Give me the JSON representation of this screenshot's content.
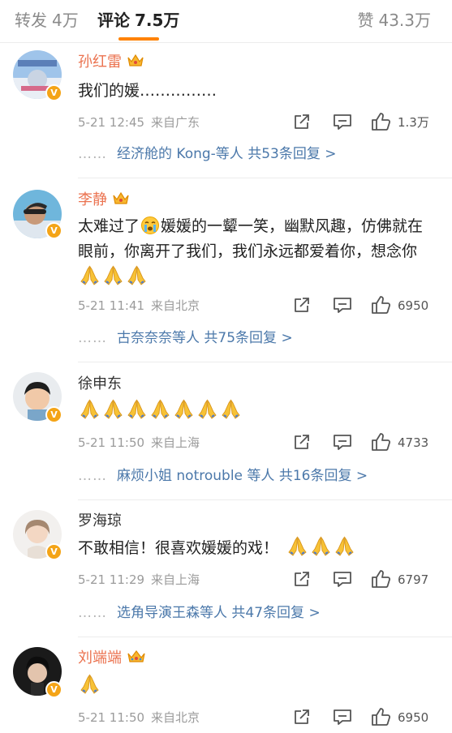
{
  "tabs": {
    "repost": {
      "label": "转发",
      "count": "4万"
    },
    "comment": {
      "label": "评论",
      "count": "7.5万"
    },
    "like": {
      "label": "赞",
      "count": "43.3万"
    }
  },
  "colors": {
    "accent": "#ff8200",
    "vip_name": "#eb7350",
    "link": "#4b78aa",
    "verified_badge": "#f4a417"
  },
  "icons": {
    "share": "share-icon",
    "reply": "comment-icon",
    "like": "thumbs-up-icon",
    "crown": "crown-icon",
    "verified": "verified-v-icon",
    "emoji_pray": "pray-emoji",
    "emoji_cry": "crying-emoji"
  },
  "comments": [
    {
      "name": "孙红雷",
      "vip": true,
      "text": [
        "我们的媛……………"
      ],
      "date": "5-21 12:45",
      "location": "来自广东",
      "likes": "1.3万",
      "replies": {
        "dots": "……",
        "users": "经济舱的 Kong-等人",
        "count": "共53条回复 >"
      }
    },
    {
      "name": "李静",
      "vip": true,
      "text": [
        "太难过了",
        "媛媛的一颦一笑，幽默风趣，仿佛就在眼前，你离开了我们，我们永远都爱着你，想念你"
      ],
      "date": "5-21 11:41",
      "location": "来自北京",
      "likes": "6950",
      "replies": {
        "dots": "……",
        "users": "古奈奈奈等人",
        "count": "共75条回复 >"
      }
    },
    {
      "name": "徐申东",
      "vip": false,
      "text": [],
      "date": "5-21 11:50",
      "location": "来自上海",
      "likes": "4733",
      "replies": {
        "dots": "……",
        "users": "麻烦小姐 notrouble 等人",
        "count": "共16条回复 >"
      }
    },
    {
      "name": "罗海琼",
      "vip": false,
      "text": [
        "不敢相信！很喜欢媛媛的戏！"
      ],
      "date": "5-21 11:29",
      "location": "来自上海",
      "likes": "6797",
      "replies": {
        "dots": "……",
        "users": "选角导演王森等人",
        "count": "共47条回复 >"
      }
    },
    {
      "name": "刘端端",
      "vip": true,
      "text": [],
      "date": "5-21 11:50",
      "location": "来自北京",
      "likes": "6950"
    }
  ]
}
